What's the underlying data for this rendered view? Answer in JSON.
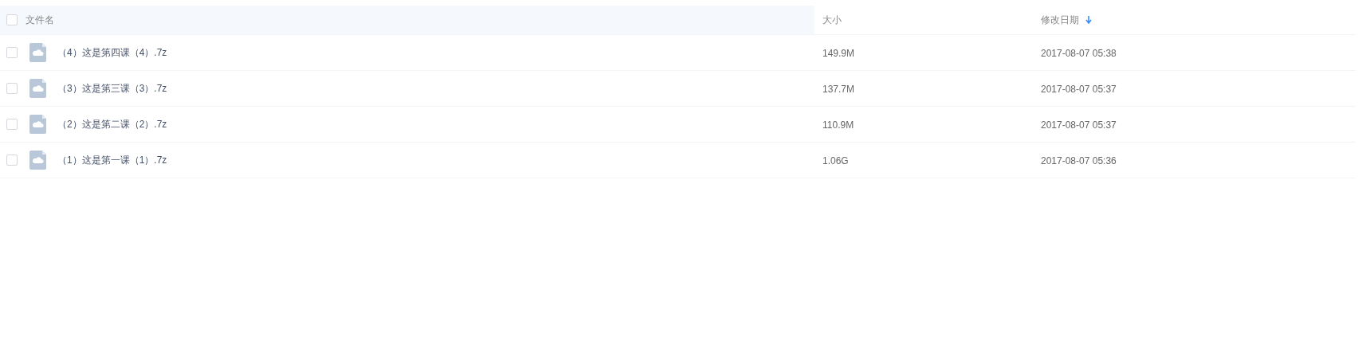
{
  "table": {
    "select_all": {
      "checked": false
    },
    "columns": [
      {
        "label": "文件名",
        "sorted": false
      },
      {
        "label": "大小",
        "sorted": false
      },
      {
        "label": "修改日期",
        "sorted": true
      }
    ],
    "rows": [
      {
        "checked": false,
        "name": "（4）这是第四课（4）.7z",
        "size": "149.9M",
        "modified": "2017-08-07 05:38"
      },
      {
        "checked": false,
        "name": "（3）这是第三课（3）.7z",
        "size": "137.7M",
        "modified": "2017-08-07 05:37"
      },
      {
        "checked": false,
        "name": "（2）这是第二课（2）.7z",
        "size": "110.9M",
        "modified": "2017-08-07 05:37"
      },
      {
        "checked": false,
        "name": "（1）这是第一课（1）.7z",
        "size": "1.06G",
        "modified": "2017-08-07 05:36"
      }
    ]
  }
}
